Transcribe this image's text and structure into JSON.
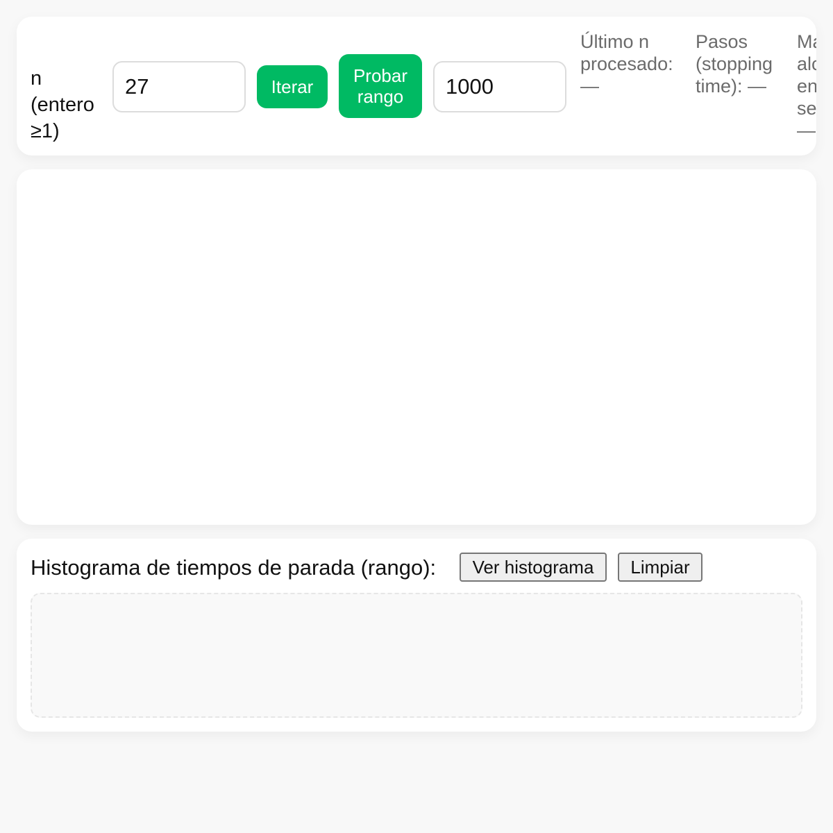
{
  "controls": {
    "n_label": "n (entero ≥1)",
    "n_value": "27",
    "iterate_label": "Iterar",
    "range_button_label": "Probar rango",
    "range_value": "1000",
    "stats": {
      "last_n": "Último n procesado: —",
      "steps": "Pasos (stopping time): —",
      "max_reached": "Máx alcanzado en secuencia: —"
    }
  },
  "histogram": {
    "title": "Histograma de tiempos de parada (rango):",
    "view_label": "Ver histograma",
    "clear_label": "Limpiar"
  },
  "colors": {
    "accent": "#00ba63",
    "background": "#f8f8f8",
    "card": "#ffffff",
    "muted_text": "#6b6b6b"
  }
}
